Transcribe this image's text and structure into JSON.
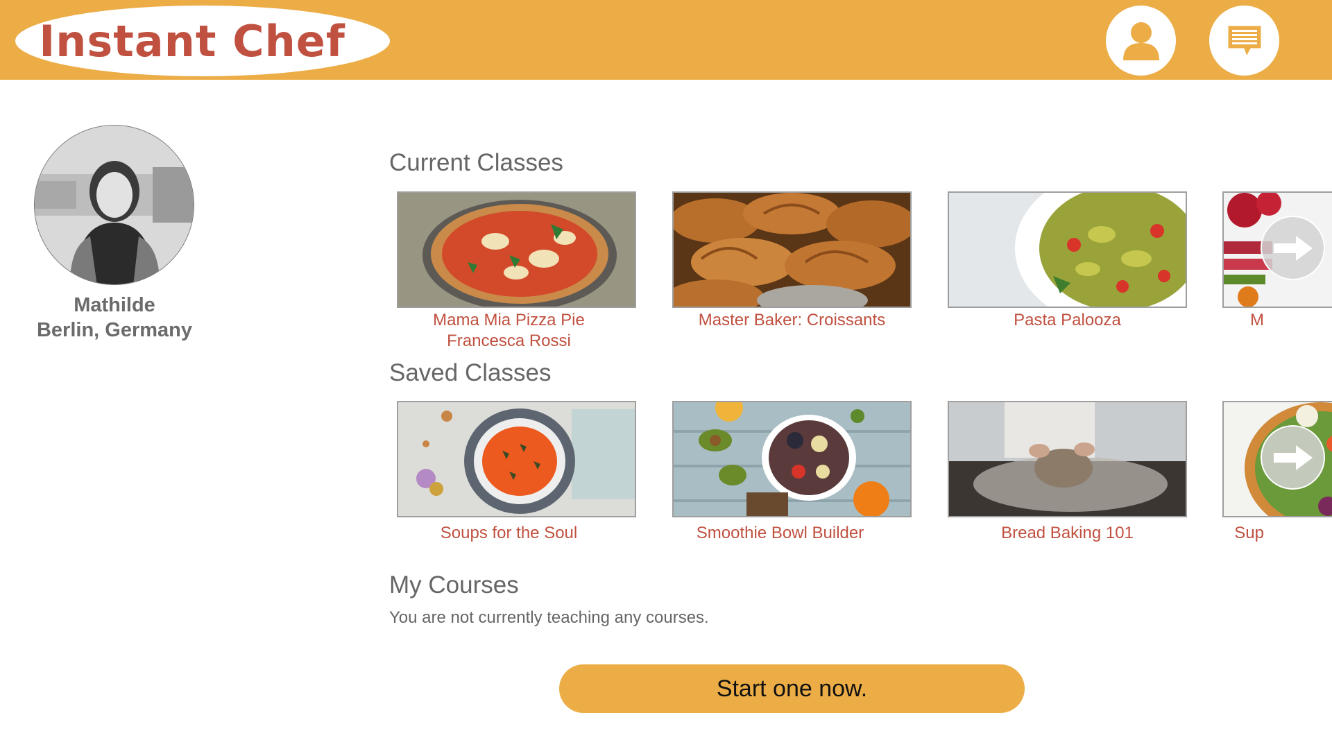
{
  "header": {
    "logo_text": "Instant Chef",
    "profile_icon": "user-icon",
    "messages_icon": "message-icon",
    "brand_color": "#ecad47",
    "accent_color": "#c0503f"
  },
  "profile": {
    "name": "Mathilde",
    "location": "Berlin, Germany"
  },
  "current_classes": {
    "title": "Current Classes",
    "items": [
      {
        "title": "Mama Mia Pizza Pie",
        "subtitle": "Francesca Rossi",
        "image": "pizza"
      },
      {
        "title": "Master Baker: Croissants",
        "image": "croissants"
      },
      {
        "title": "Pasta Palooza",
        "image": "pasta-salad"
      },
      {
        "title": "M",
        "image": "fruit"
      }
    ],
    "next_icon": "arrow-right-icon"
  },
  "saved_classes": {
    "title": "Saved Classes",
    "items": [
      {
        "title": "Soups for the Soul",
        "image": "tomato-soup"
      },
      {
        "title": "Smoothie Bowl Builder",
        "image": "smoothie-bowl"
      },
      {
        "title": "Bread Baking 101",
        "image": "bread-dough"
      },
      {
        "title": "Sup",
        "image": "salad-bowl"
      }
    ],
    "next_icon": "arrow-right-icon"
  },
  "my_courses": {
    "title": "My Courses",
    "message": "You are not currently teaching any courses.",
    "cta_label": "Start one now."
  }
}
